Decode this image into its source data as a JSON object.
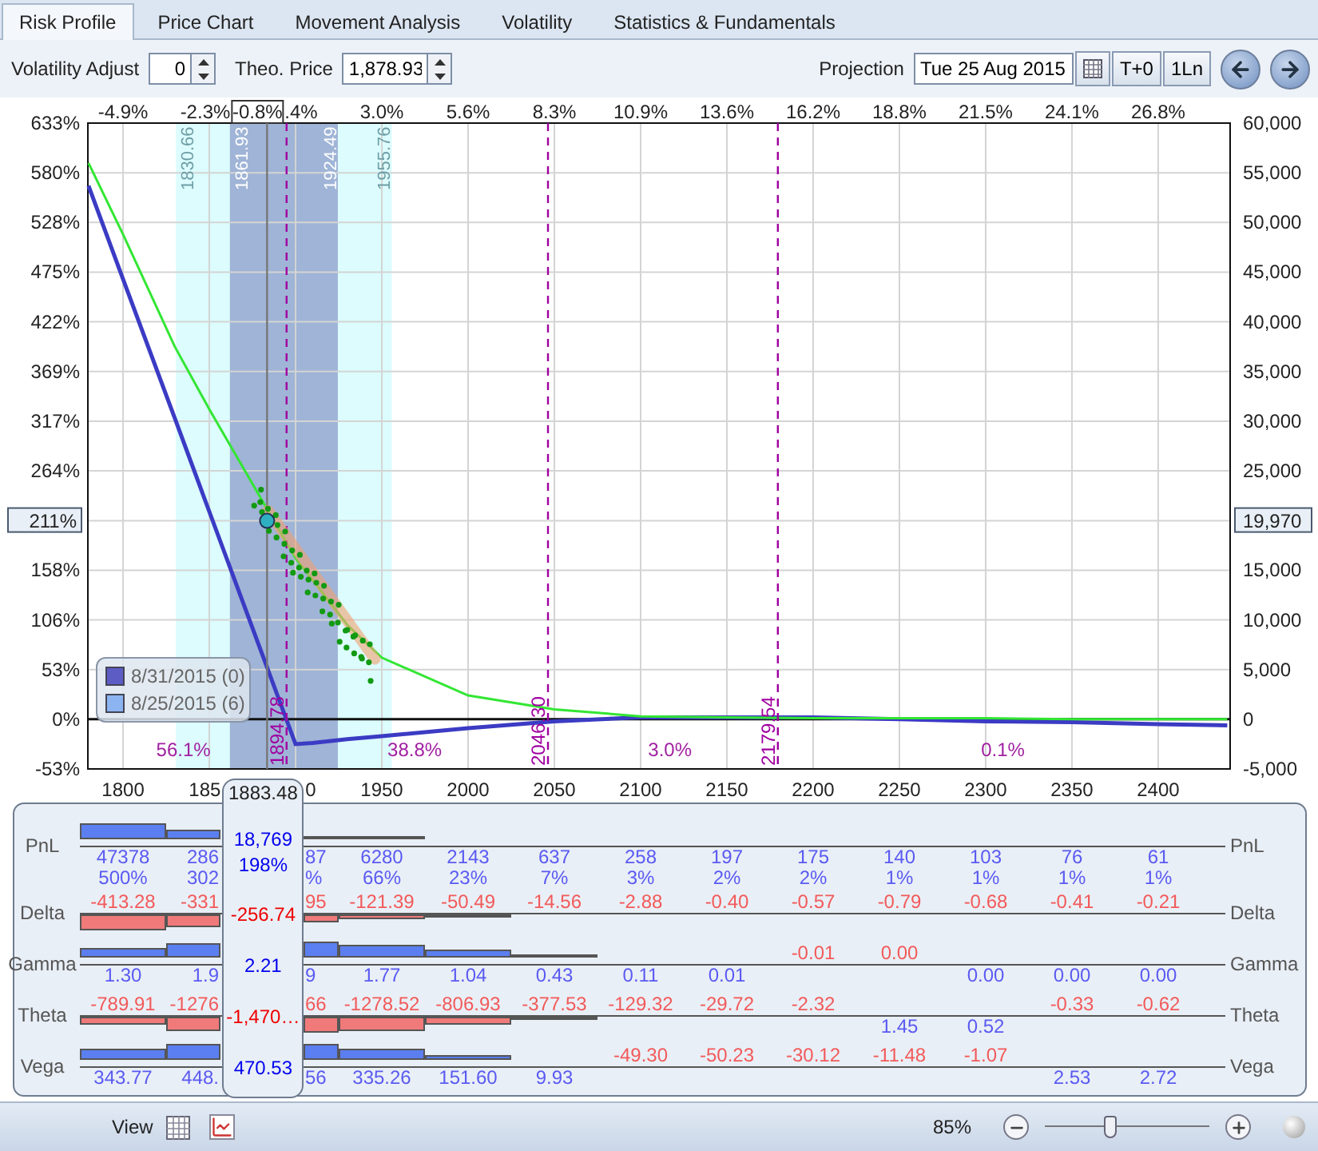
{
  "tabs": [
    {
      "label": "Risk Profile",
      "selected": true
    },
    {
      "label": "Price Chart",
      "selected": false
    },
    {
      "label": "Movement Analysis",
      "selected": false
    },
    {
      "label": "Volatility",
      "selected": false
    },
    {
      "label": "Statistics & Fundamentals",
      "selected": false
    }
  ],
  "toolbar": {
    "volatility_adjust": {
      "label": "Volatility Adjust",
      "value": "0"
    },
    "theo_price": {
      "label": "Theo. Price",
      "value": "1,878.93"
    },
    "projection": {
      "label": "Projection",
      "value": "Tue 25 Aug 2015"
    },
    "buttons": [
      {
        "label": "T+0"
      },
      {
        "label": "1Ln"
      }
    ]
  },
  "chart": {
    "chart_data": {
      "type": "line",
      "grid": true,
      "x": [
        1780,
        1800,
        1830,
        1850,
        1900,
        1910,
        1930,
        1950,
        2000,
        2050,
        2100,
        2150,
        2200,
        2250,
        2300,
        2350,
        2400,
        2440
      ],
      "series": [
        {
          "name": "8/31/2015 (0)",
          "color": "#3b3bc4",
          "values": [
            53700,
            44300,
            30300,
            20900,
            -2500,
            -2400,
            -2000,
            -1700,
            -900,
            -200,
            200,
            200,
            200,
            0,
            -200,
            -300,
            -500,
            -600
          ]
        },
        {
          "name": "8/25/2015 (6)",
          "color": "#33e633",
          "values": [
            56000,
            48800,
            37500,
            31200,
            16200,
            14000,
            9500,
            6200,
            2400,
            1000,
            300,
            200,
            100,
            100,
            100,
            0,
            0,
            0
          ]
        }
      ],
      "xlim": [
        1779.6,
        2441.7
      ],
      "ylim": [
        -5000,
        60000
      ],
      "xticks": [
        {
          "value": 1800,
          "label": "1800"
        },
        {
          "value": 1950,
          "label": "1950"
        },
        {
          "value": 2000,
          "label": "2000"
        },
        {
          "value": 2050,
          "label": "2050"
        },
        {
          "value": 2100,
          "label": "2100"
        },
        {
          "value": 2150,
          "label": "2150"
        },
        {
          "value": 2200,
          "label": "2200"
        },
        {
          "value": 2250,
          "label": "2250"
        },
        {
          "value": 2300,
          "label": "2300"
        },
        {
          "value": 2350,
          "label": "2350"
        },
        {
          "value": 2400,
          "label": "2400"
        }
      ],
      "yticks": [
        {
          "value": 60000,
          "label": "60,000"
        },
        {
          "value": 55000,
          "label": "55,000"
        },
        {
          "value": 50000,
          "label": "50,000"
        },
        {
          "value": 45000,
          "label": "45,000"
        },
        {
          "value": 40000,
          "label": "40,000"
        },
        {
          "value": 35000,
          "label": "35,000"
        },
        {
          "value": 30000,
          "label": "30,000"
        },
        {
          "value": 25000,
          "label": "25,000"
        },
        {
          "value": 15000,
          "label": "15,000"
        },
        {
          "value": 10000,
          "label": "10,000"
        },
        {
          "value": 5000,
          "label": "5,000"
        },
        {
          "value": 0,
          "label": "0"
        },
        {
          "value": -5000,
          "label": "-5,000"
        }
      ]
    },
    "markers": [
      "1894.78",
      "2046.30",
      "2179.54"
    ],
    "covered_x_labels": [
      "185",
      "0"
    ],
    "left_ticks": [
      "633%",
      "580%",
      "528%",
      "475%",
      "422%",
      "369%",
      "317%",
      "264%",
      "158%",
      "106%",
      "53%",
      "0%",
      "-53%"
    ],
    "top_ticks": [
      "-4.9%",
      "-2.3%",
      ".4%",
      "3.0%",
      "5.6%",
      "8.3%",
      "10.9%",
      "13.6%",
      "16.2%",
      "18.8%",
      "21.5%",
      "24.1%",
      "26.8%"
    ],
    "bands": [
      {
        "kind": "outer",
        "from_label": "1830.66",
        "to_label": "1955.76"
      },
      {
        "kind": "inner",
        "from_label": "1861.93",
        "to_label": "1924.49"
      }
    ],
    "zone_labels": [
      "56.1%",
      "38.8%",
      "3.0%",
      "0.1%"
    ],
    "legend": [
      {
        "color": "#5c5cc4"
      },
      {
        "color": "#8cb4f0"
      }
    ],
    "cursor": {
      "change": "-0.8%",
      "pct": "211%",
      "pnl": "19,970",
      "price": "1883.48"
    }
  },
  "table": {
    "rows": [
      {
        "label": "PnL",
        "right_label": "PnL",
        "cells": [
          {
            "text": "47378",
            "sub": "500%",
            "negative": false
          },
          {
            "text": "286",
            "sub": "302",
            "negative": false
          },
          {
            "text": "87",
            "sub": "%",
            "negative": false
          },
          {
            "text": "6280",
            "sub": "66%",
            "negative": false
          },
          {
            "text": "2143",
            "sub": "23%",
            "negative": false
          },
          {
            "text": "637",
            "sub": "7%",
            "negative": false
          },
          {
            "text": "258",
            "sub": "3%",
            "negative": false
          },
          {
            "text": "197",
            "sub": "2%",
            "negative": false
          },
          {
            "text": "175",
            "sub": "2%",
            "negative": false
          },
          {
            "text": "140",
            "sub": "1%",
            "negative": false
          },
          {
            "text": "103",
            "sub": "1%",
            "negative": false
          },
          {
            "text": "76",
            "sub": "1%",
            "negative": false
          },
          {
            "text": "61",
            "sub": "1%",
            "negative": false
          }
        ]
      },
      {
        "label": "Delta",
        "right_label": "Delta",
        "cells": [
          {
            "text": "-413.28",
            "negative": true
          },
          {
            "text": "-331",
            "negative": true
          },
          {
            "text": "95",
            "negative": true
          },
          {
            "text": "-121.39",
            "negative": true
          },
          {
            "text": "-50.49",
            "negative": true
          },
          {
            "text": "-14.56",
            "negative": true
          },
          {
            "text": "-2.88",
            "negative": true
          },
          {
            "text": "-0.40",
            "negative": true
          },
          {
            "text": "-0.57",
            "negative": true
          },
          {
            "text": "-0.79",
            "negative": true
          },
          {
            "text": "-0.68",
            "negative": true
          },
          {
            "text": "-0.41",
            "negative": true
          },
          {
            "text": "-0.21",
            "negative": true
          }
        ]
      },
      {
        "label": "Gamma",
        "right_label": "Gamma",
        "cells": [
          {
            "text": "1.30",
            "negative": false
          },
          {
            "text": "1.9",
            "negative": false
          },
          {
            "text": "9",
            "negative": false
          },
          {
            "text": "1.77",
            "negative": false
          },
          {
            "text": "1.04",
            "negative": false
          },
          {
            "text": "0.43",
            "negative": false
          },
          {
            "text": "0.11",
            "negative": false
          },
          {
            "text": "0.01",
            "negative": false
          },
          {
            "text": "-0.01",
            "negative": true
          },
          {
            "text": "0.00",
            "negative": true
          },
          {
            "text": "0.00",
            "negative": false
          },
          {
            "text": "0.00",
            "negative": false
          },
          {
            "text": "0.00",
            "negative": false
          }
        ]
      },
      {
        "label": "Theta",
        "right_label": "Theta",
        "cells": [
          {
            "text": "-789.91",
            "negative": true
          },
          {
            "text": "-1276",
            "negative": true
          },
          {
            "text": "66",
            "negative": true
          },
          {
            "text": "-1278.52",
            "negative": true
          },
          {
            "text": "-806.93",
            "negative": true
          },
          {
            "text": "-377.53",
            "negative": true
          },
          {
            "text": "-129.32",
            "negative": true
          },
          {
            "text": "-29.72",
            "negative": true
          },
          {
            "text": "-2.32",
            "negative": true
          },
          {
            "text": "1.45",
            "negative": false
          },
          {
            "text": "0.52",
            "negative": false
          },
          {
            "text": "-0.33",
            "negative": true
          },
          {
            "text": "-0.62",
            "negative": true
          }
        ]
      },
      {
        "label": "Vega",
        "right_label": "Vega",
        "cells": [
          {
            "text": "343.77",
            "negative": false
          },
          {
            "text": "448.",
            "negative": false
          },
          {
            "text": "56",
            "negative": false
          },
          {
            "text": "335.26",
            "negative": false
          },
          {
            "text": "151.60",
            "negative": false
          },
          {
            "text": "9.93",
            "negative": false
          },
          {
            "text": "-49.30",
            "negative": true
          },
          {
            "text": "-50.23",
            "negative": true
          },
          {
            "text": "-30.12",
            "negative": true
          },
          {
            "text": "-11.48",
            "negative": true
          },
          {
            "text": "-1.07",
            "negative": true
          },
          {
            "text": "2.53",
            "negative": false
          },
          {
            "text": "2.72",
            "negative": false
          }
        ]
      }
    ],
    "cursor_rows": [
      {
        "values": [
          "18,769",
          "198%"
        ],
        "negative": false
      },
      {
        "values": [
          "-256.74"
        ],
        "negative": true
      },
      {
        "values": [
          "2.21"
        ],
        "negative": false
      },
      {
        "values": [
          "-1,470…"
        ],
        "negative": true
      },
      {
        "values": [
          "470.53"
        ],
        "negative": false
      }
    ]
  },
  "status_bar": {
    "view_label": "View",
    "zoom": "85%",
    "zoom_slider": {
      "level": 0.4
    }
  }
}
